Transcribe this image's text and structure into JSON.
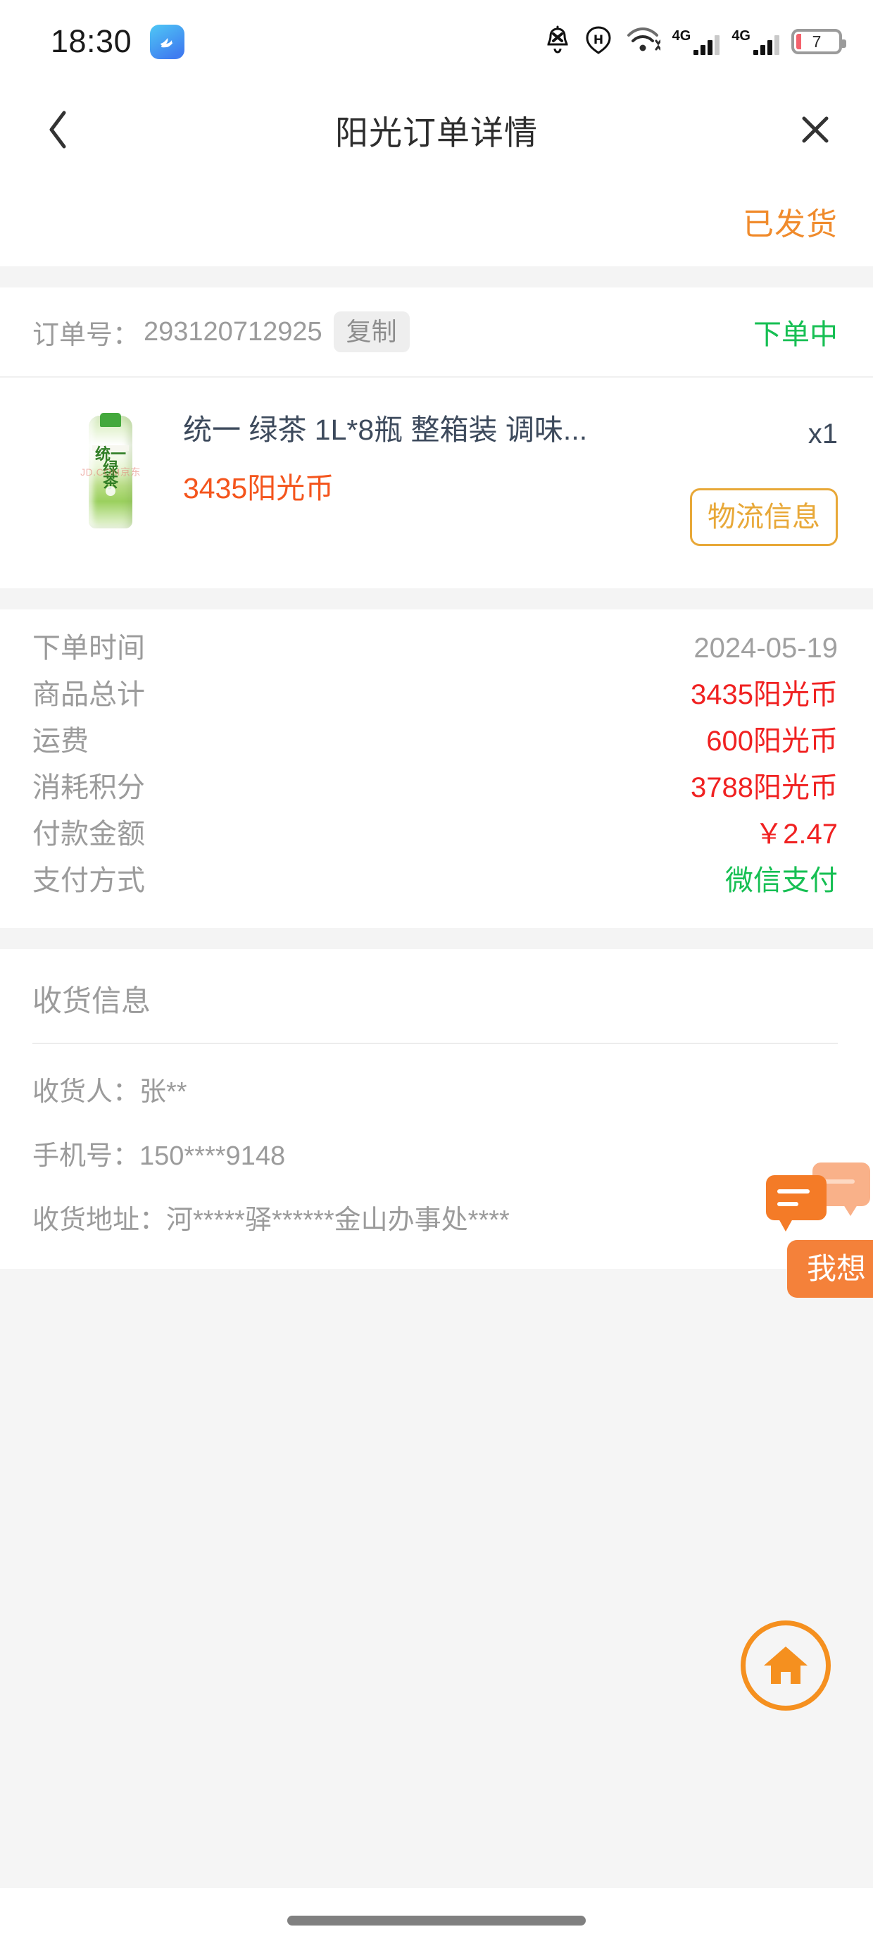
{
  "status_bar": {
    "time": "18:30",
    "app_badge_icon": "weather-app-icon",
    "icons": {
      "notification_muted": "bell-mute-icon",
      "network_type": "H",
      "wifi": "wifi-icon",
      "sim1_label": "4G",
      "sim2_label": "4G"
    },
    "battery_percent": "7"
  },
  "title_bar": {
    "back_icon": "chevron-left-icon",
    "title": "阳光订单详情",
    "close_icon": "close-icon"
  },
  "order_status": {
    "state": "已发货"
  },
  "order_number": {
    "label": "订单号：",
    "value": "293120712925",
    "copy_label": "复制",
    "sub_state": "下单中"
  },
  "product": {
    "thumb_alt": "green-tea-bottle",
    "thumb_watermark": "JD.COM京东",
    "bottle_text_line1": "统一",
    "bottle_text_line2": "绿",
    "bottle_text_line3": "茶",
    "title": "统一 绿茶 1L*8瓶 整箱装 调味...",
    "price": "3435阳光币",
    "quantity": "x1",
    "logistics_label": "物流信息"
  },
  "summary": {
    "rows": [
      {
        "label": "下单时间",
        "value": "2024-05-19",
        "tone": "gray"
      },
      {
        "label": "商品总计",
        "value": "3435阳光币",
        "tone": "red"
      },
      {
        "label": "运费",
        "value": "600阳光币",
        "tone": "red"
      },
      {
        "label": "消耗积分",
        "value": "3788阳光币",
        "tone": "red"
      },
      {
        "label": "付款金额",
        "value": "￥2.47",
        "tone": "red"
      },
      {
        "label": "支付方式",
        "value": "微信支付",
        "tone": "green"
      }
    ]
  },
  "receiver": {
    "section_title": "收货信息",
    "name_line": "收货人：张**",
    "phone_line": "手机号：150****9148",
    "address_line": "收货地址：河*****驿******金山办事处****"
  },
  "floating": {
    "chat_label": "我想",
    "chat_icon": "chat-bubbles-icon",
    "home_icon": "home-icon"
  },
  "colors": {
    "accent_orange": "#f08b2c",
    "price_red": "#f4551d",
    "value_red": "#f02121",
    "green": "#16bf53",
    "logistics_gold": "#e8a838",
    "chat_orange": "#f4813a",
    "home_orange": "#f5901f"
  }
}
